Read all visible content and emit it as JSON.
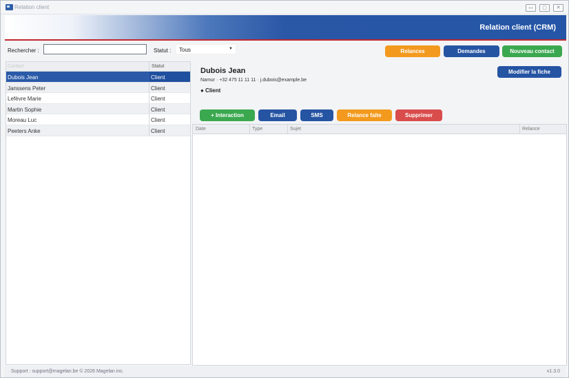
{
  "window": {
    "title": "Relation client",
    "app_icon": "app-icon"
  },
  "banner": {
    "title": "Relation client (CRM)",
    "accent_color": "#c0282e",
    "brand_color": "#2555a6"
  },
  "search": {
    "label": "Rechercher :",
    "value": "",
    "status_label": "Statut :",
    "status_value": "Tous"
  },
  "toolbar": {
    "relances": "Relances",
    "demandes": "Demandes",
    "nouveau_contact": "Nouveau contact"
  },
  "contacts": {
    "columns": [
      "Contact",
      "Statut"
    ],
    "rows": [
      {
        "name": "Dubois Jean",
        "status": "Client"
      },
      {
        "name": "Janssens Peter",
        "status": "Client"
      },
      {
        "name": "Lefèvre Marie",
        "status": "Client"
      },
      {
        "name": "Martin Sophie",
        "status": "Client"
      },
      {
        "name": "Moreau Luc",
        "status": "Client"
      },
      {
        "name": "Peeters Anke",
        "status": "Client"
      }
    ]
  },
  "detail": {
    "name": "Dubois Jean",
    "meta": "Namur  ·  +32 475 11 11 11  ·  j.dubois@example.be",
    "status": "● Client",
    "modify_button": "Modifier la fiche"
  },
  "actions": {
    "interaction": "+ Interaction",
    "email": "Email",
    "sms": "SMS",
    "relance_faite": "Relance faite",
    "supprimer": "Supprimer"
  },
  "interactions": {
    "columns": [
      "Date",
      "Type",
      "Sujet",
      "Relance"
    ]
  },
  "footer": {
    "support": "Support : support@magelan.be   © 2026 Magelan inc.",
    "version": "v1.3.0"
  }
}
